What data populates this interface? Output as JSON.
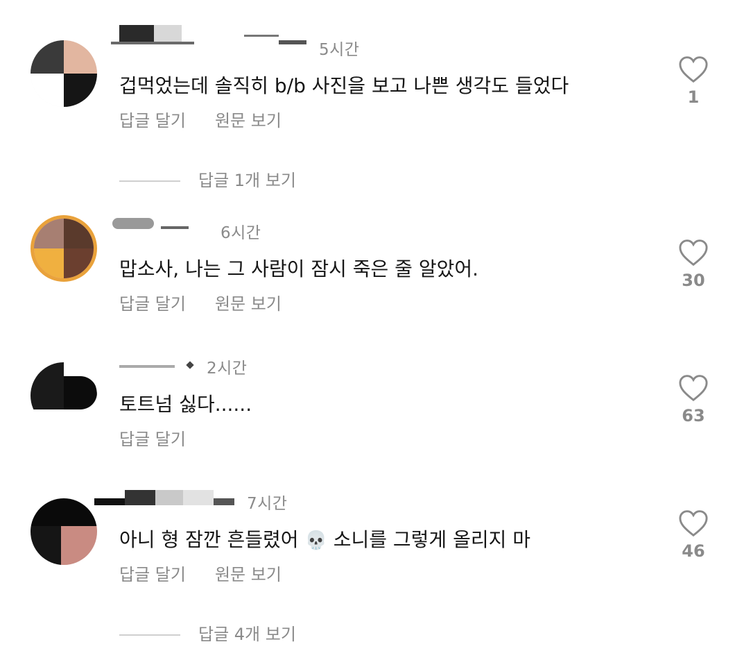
{
  "comments": [
    {
      "time": "5시간",
      "text": "겁먹었는데 솔직히 b/b 사진을 보고 나쁜 생각도 들었다",
      "reply_label": "답글 달기",
      "translate_label": "원문 보기",
      "likes": "1",
      "view_replies": "답글 1개 보기"
    },
    {
      "time": "6시간",
      "text": "맙소사, 나는 그 사람이 잠시 죽은 줄 알았어.",
      "reply_label": "답글 달기",
      "translate_label": "원문 보기",
      "likes": "30"
    },
    {
      "time": "2시간",
      "text": "토트넘 싫다......",
      "reply_label": "답글 달기",
      "likes": "63"
    },
    {
      "time": "7시간",
      "text_before": "아니 형 잠깐 흔들렸어",
      "emoji": "💀",
      "text_after": "소니를 그렇게 올리지 마",
      "reply_label": "답글 달기",
      "translate_label": "원문 보기",
      "likes": "46",
      "view_replies": "답글 4개 보기"
    }
  ],
  "colors": {
    "muted": "#8a8a8a",
    "text": "#161616",
    "story_ring": "#e9a23b"
  },
  "icons": [
    "heart-outline-icon"
  ]
}
